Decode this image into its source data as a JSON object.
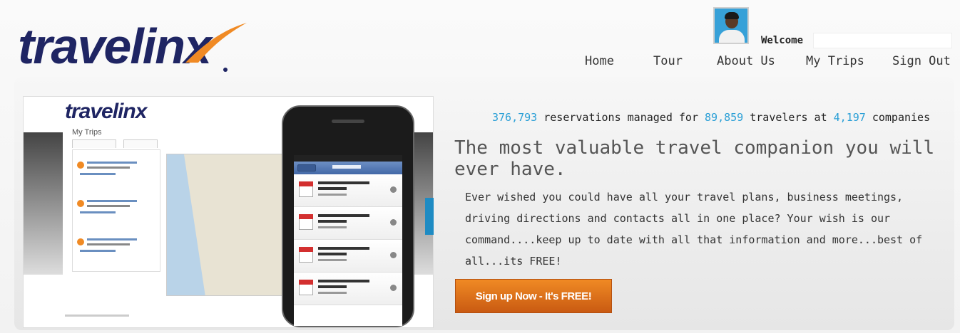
{
  "header": {
    "logo_text": "travelinx",
    "welcome_label": "Welcome",
    "welcome_name": "",
    "nav": [
      "Home",
      "Tour",
      "About Us",
      "My Trips",
      "Sign Out"
    ]
  },
  "preview": {
    "logo_text": "travelinx",
    "page_title": "My Trips"
  },
  "stats": {
    "reservations": "376,793",
    "reservations_text": " reservations managed for ",
    "travelers": "89,859",
    "travelers_text": " travelers at ",
    "companies": "4,197",
    "companies_text": " companies"
  },
  "headline": "The most valuable travel companion you will ever have.",
  "description": "Ever wished you could have all your travel plans, business meetings, driving directions and contacts all in one place? Your wish is our command....keep up to date with all that information and more...best of all...its FREE!",
  "cta_label": "Sign up Now - It's FREE!",
  "colors": {
    "brand_navy": "#1f2563",
    "brand_orange": "#f08a24",
    "stat_blue": "#2a9fd6"
  }
}
